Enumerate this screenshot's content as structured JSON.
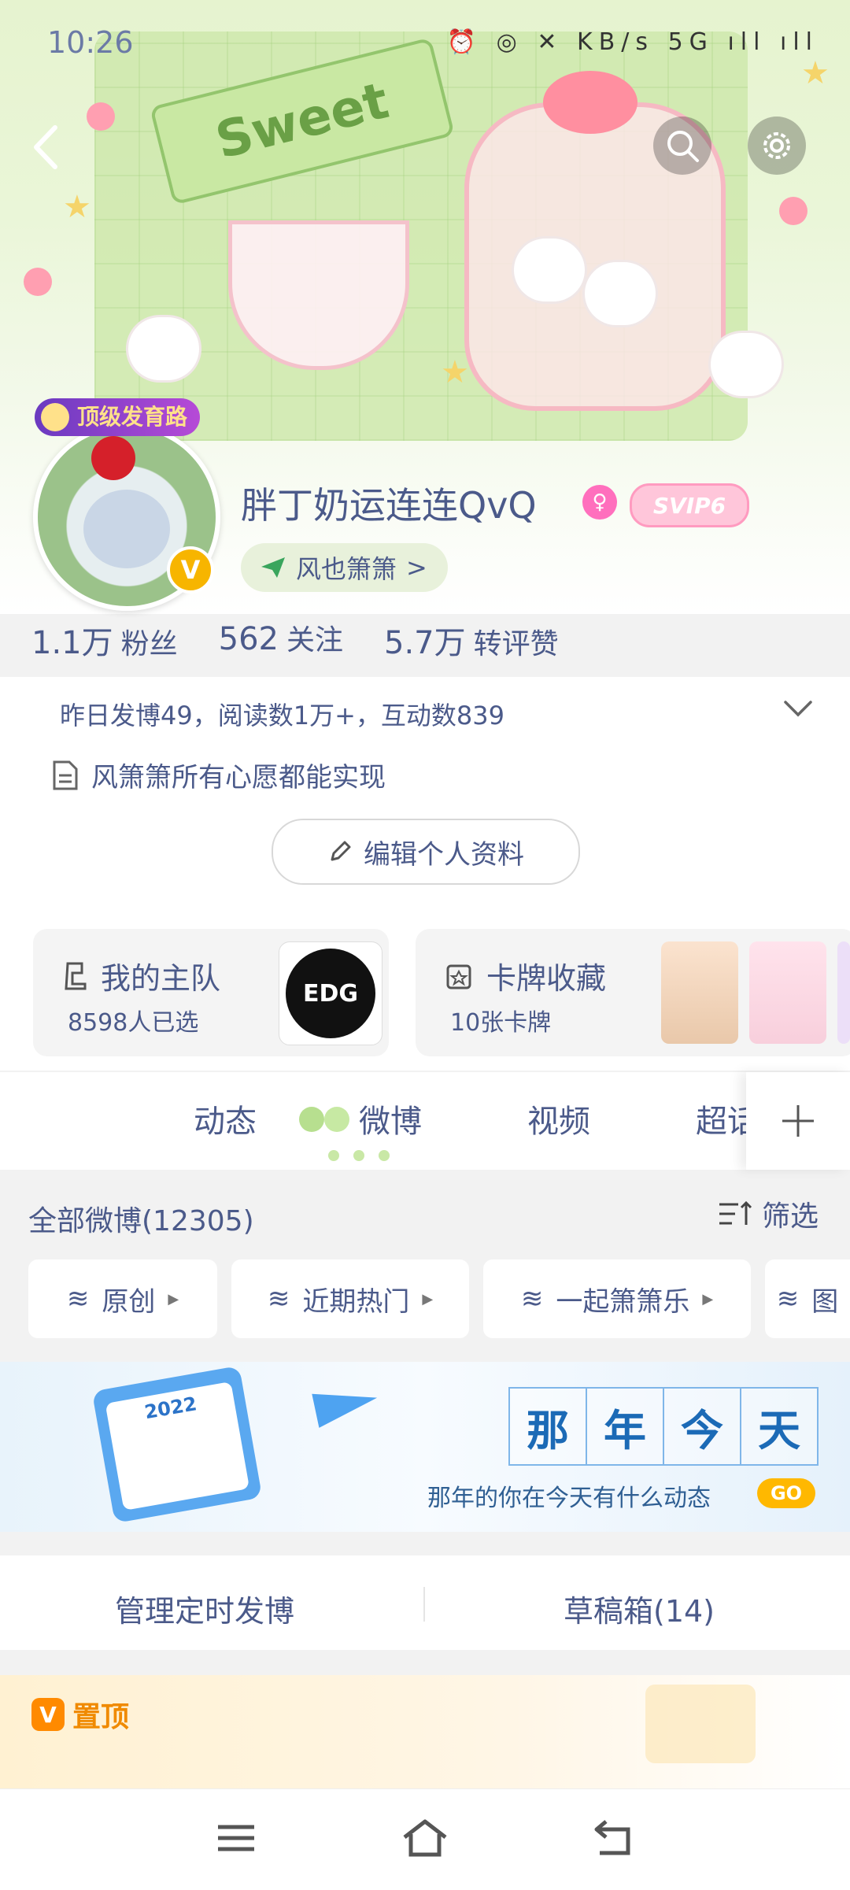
{
  "status_bar": {
    "time": "10:26",
    "network": "5G",
    "icons_text": "⏰ ◎ ✕ KB/s 5G ıll ıll"
  },
  "header": {
    "banner_text": "Sweet",
    "back_icon": "chevron-left-icon",
    "search_icon": "search-icon",
    "settings_icon": "gear-icon"
  },
  "profile": {
    "top_badge": "顶级发育路",
    "username": "胖丁奶运连连QvQ",
    "gender_icon": "female-icon",
    "vip_badge": "SVIP6",
    "verified_mark": "V",
    "fan_group": "风也箫箫",
    "fan_group_chevron": ">"
  },
  "stats": {
    "fans_value": "1.1万",
    "fans_label": "粉丝",
    "following_value": "562",
    "following_label": "关注",
    "interactions_value": "5.7万",
    "interactions_label": "转评赞"
  },
  "summary": {
    "daily_stats": "昨日发博49，阅读数1万+，互动数839",
    "intro": "风箫箫所有心愿都能实现",
    "edit_button": "编辑个人资料"
  },
  "cards": {
    "team_title": "我的主队",
    "team_sub": "8598人已选",
    "team_logo": "EDG",
    "cards_title": "卡牌收藏",
    "cards_sub": "10张卡牌"
  },
  "tabs": {
    "items": [
      "动态",
      "微博",
      "视频",
      "超话"
    ],
    "active": "微博",
    "add": "+"
  },
  "weibo": {
    "all_label": "全部微博(12305)",
    "filter_label": "筛选",
    "chips": [
      "原创",
      "近期热门",
      "一起箫箫乐",
      "图"
    ]
  },
  "memory_banner": {
    "title_chars": [
      "那",
      "年",
      "今",
      "天"
    ],
    "subtitle": "那年的你在今天有什么动态",
    "go": "GO",
    "calendar_year": "2022"
  },
  "manage": {
    "left": "管理定时发博",
    "right": "草稿箱(14)"
  },
  "pinned": {
    "label": "置顶",
    "icon": "V"
  },
  "colors": {
    "accent_text": "#4b5a8a",
    "go_yellow": "#ffb800",
    "pin_orange": "#f08a00"
  }
}
